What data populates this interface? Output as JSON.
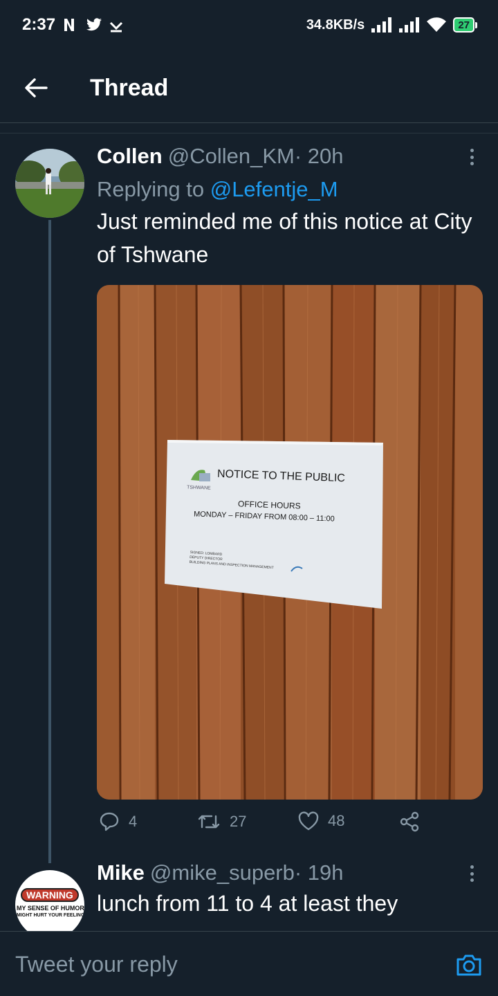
{
  "status_bar": {
    "time": "2:37",
    "network_speed": "34.8KB/s",
    "battery": "27"
  },
  "header": {
    "title": "Thread"
  },
  "tweets": [
    {
      "name": "Collen",
      "handle": "@Collen_KM",
      "time": " · 20h",
      "replying_prefix": "Replying to ",
      "replying_to": "@Lefentje_M",
      "text": "Just reminded me of this notice at City of Tshwane",
      "media": {
        "notice_title": "NOTICE TO THE PUBLIC",
        "notice_line1": "OFFICE HOURS",
        "notice_line2": "MONDAY – FRIDAY FROM 08:00 – 11:00",
        "logo_text": "TSHWANE",
        "signature_lines": [
          "SIGNED: LOMBARD",
          "DEPUTY DIRECTOR",
          "BUILDING PLANS AND INSPECTION MANAGEMENT"
        ]
      },
      "actions": {
        "replies": "4",
        "retweets": "27",
        "likes": "48"
      }
    },
    {
      "name": "Mike",
      "handle": "@mike_superb",
      "time": " · 19h",
      "text": "lunch from 11 to 4 at least they",
      "avatar_text": {
        "warning": "WARNING",
        "line1": "MY SENSE OF HUMOR",
        "line2": "MIGHT HURT YOUR FEELINGS"
      }
    }
  ],
  "reply_bar": {
    "placeholder": "Tweet your reply"
  },
  "colors": {
    "background": "#15202b",
    "accent": "#1d9bf0",
    "secondary_text": "#8899a6"
  }
}
